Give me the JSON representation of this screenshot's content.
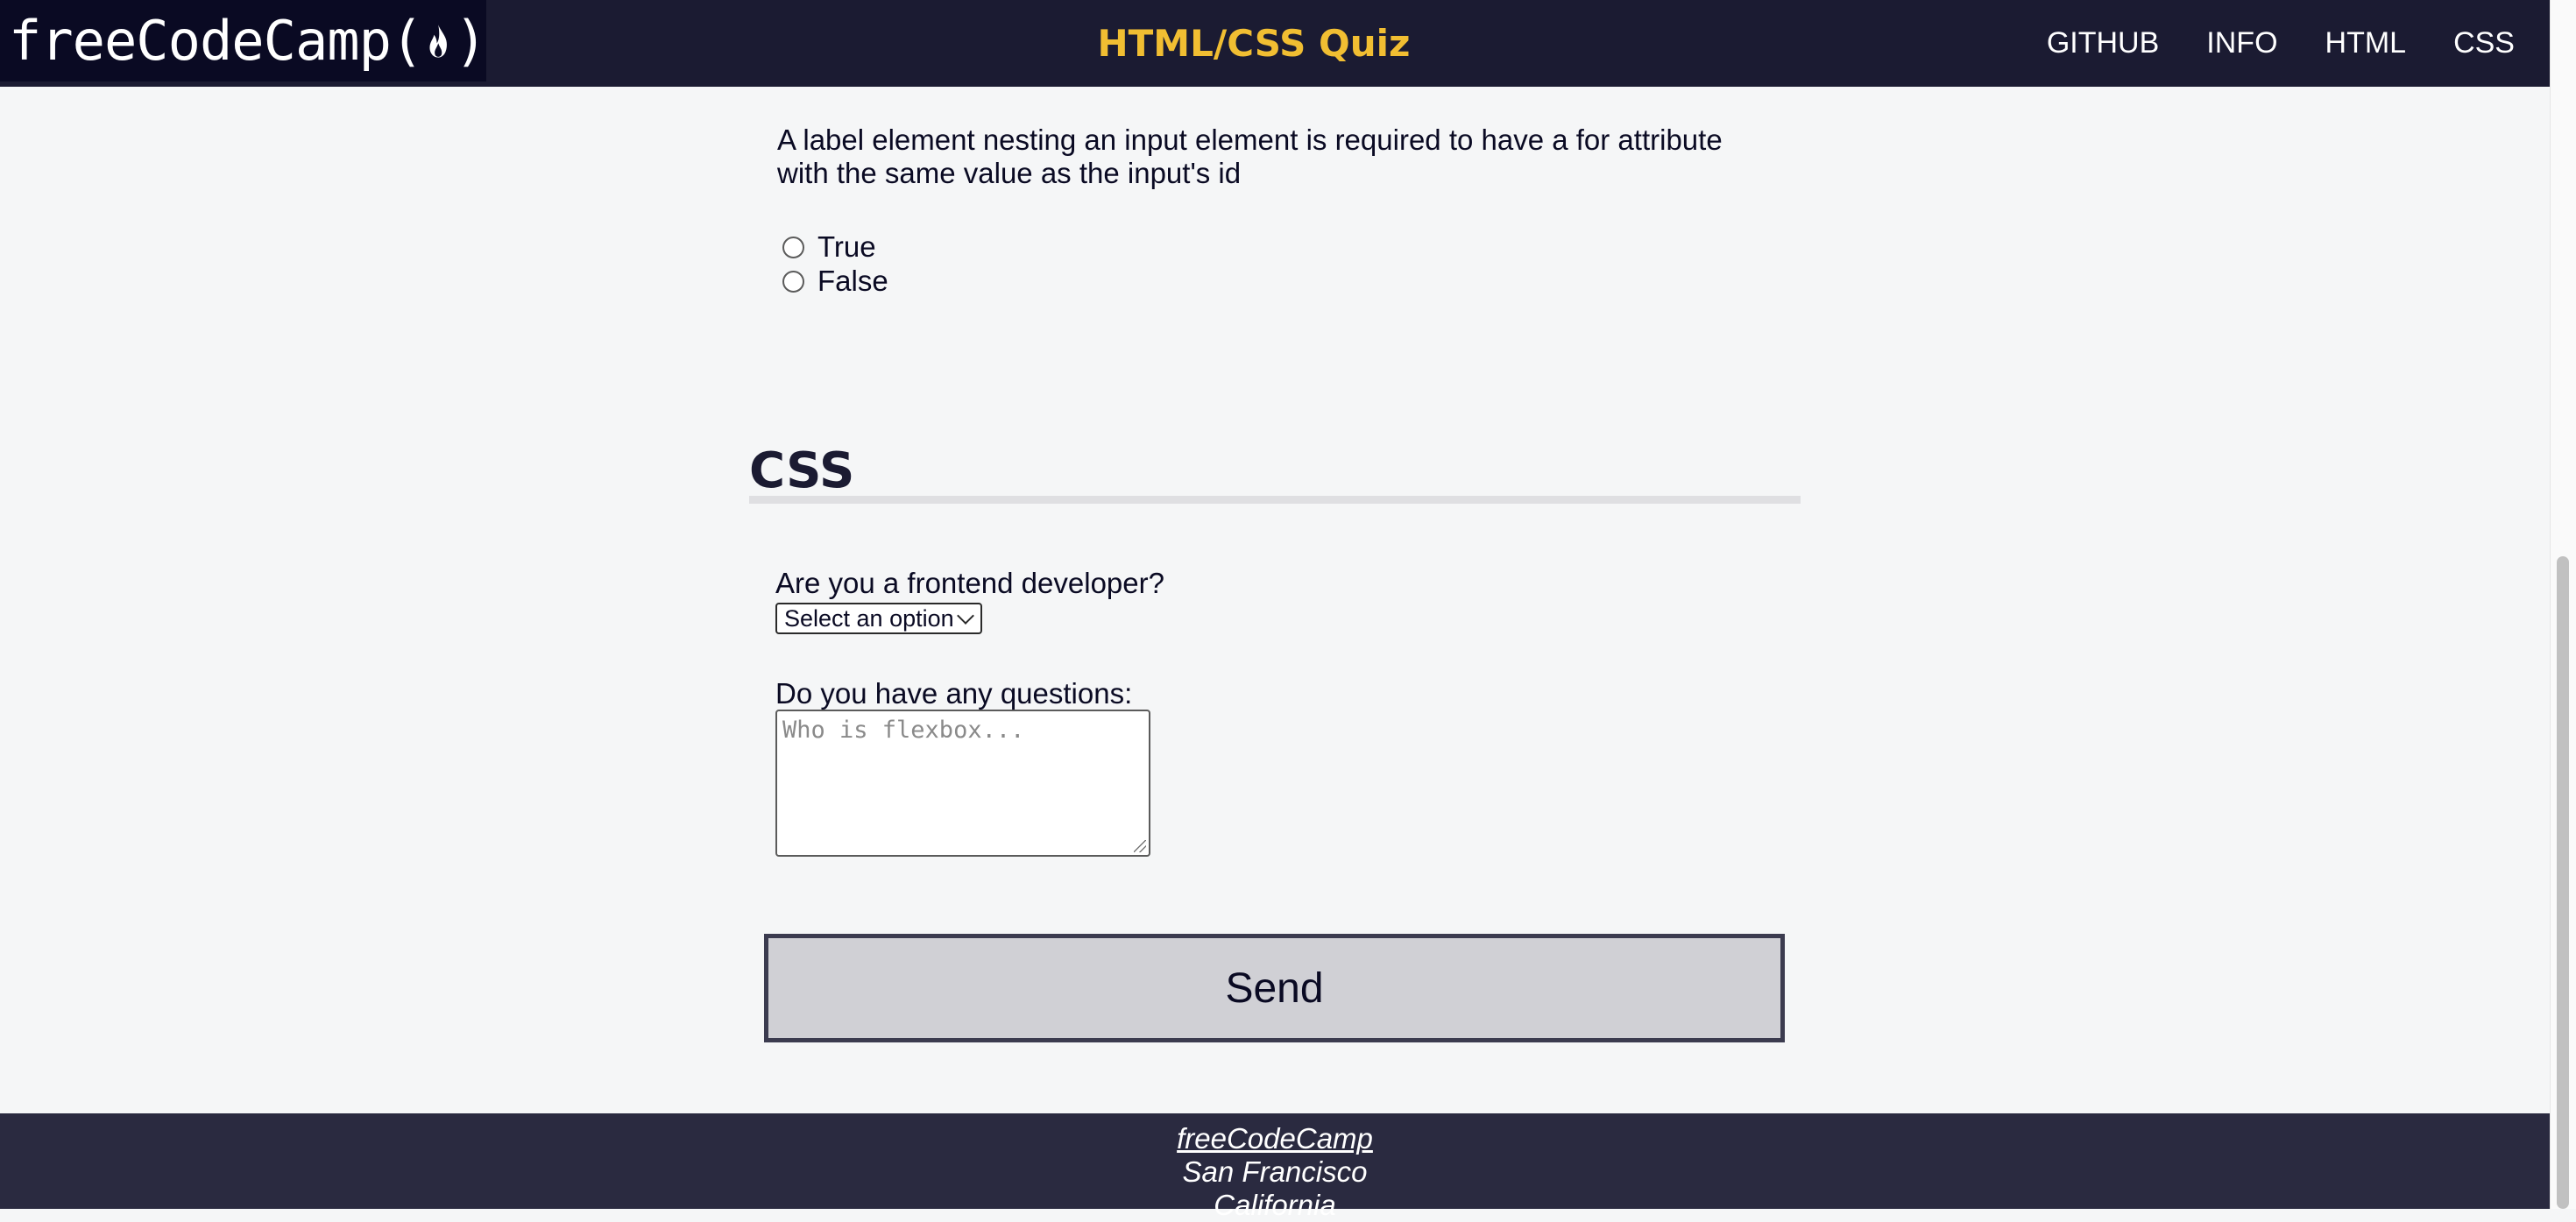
{
  "header": {
    "logo_text_left": "freeCodeCamp(",
    "logo_text_right": ")",
    "title": "HTML/CSS Quiz",
    "nav": [
      "GITHUB",
      "INFO",
      "HTML",
      "CSS"
    ]
  },
  "html_question": {
    "text": "A label element nesting an input element is required to have a for attribute with the same value as the input's id",
    "options": [
      "True",
      "False"
    ]
  },
  "css_section": {
    "title": "CSS",
    "frontend_label": "Are you a frontend developer?",
    "frontend_select_value": "Select an option",
    "questions_label": "Do you have any questions:",
    "questions_placeholder": "Who is flexbox..."
  },
  "send_label": "Send",
  "footer": {
    "link": "freeCodeCamp",
    "line2": "San Francisco",
    "line3": "California"
  },
  "colors": {
    "header_bg": "#1b1b32",
    "title_accent": "#f1be32",
    "button_bg": "#d0d0d5",
    "footer_bg": "#2a2a40"
  }
}
